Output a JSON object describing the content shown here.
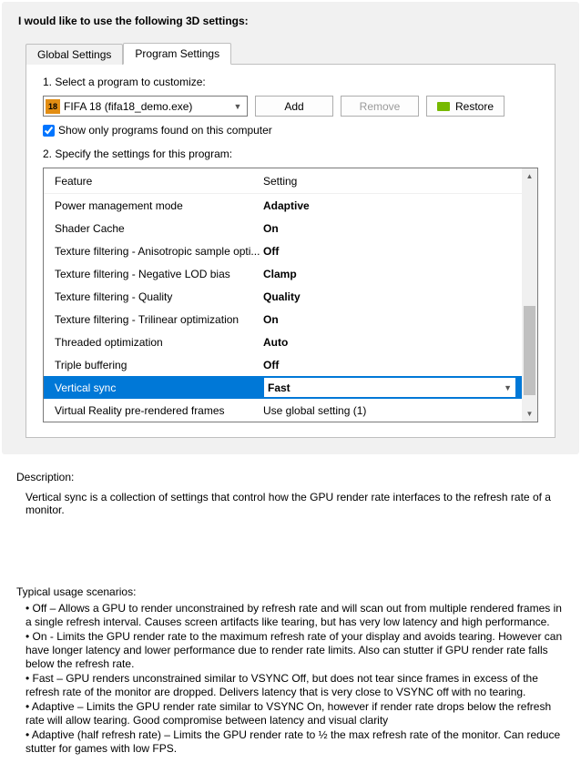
{
  "panel": {
    "title": "I would like to use the following 3D settings:"
  },
  "tabs": {
    "global": "Global Settings",
    "program": "Program Settings"
  },
  "step1": {
    "label": "1. Select a program to customize:",
    "program_icon_text": "18",
    "program_text": "FIFA 18 (fifa18_demo.exe)",
    "add": "Add",
    "remove": "Remove",
    "restore": "Restore",
    "checkbox_checked": true,
    "checkbox_label": "Show only programs found on this computer"
  },
  "step2": {
    "label": "2. Specify the settings for this program:",
    "header_feature": "Feature",
    "header_setting": "Setting",
    "rows": [
      {
        "feature": "Power management mode",
        "setting": "Adaptive"
      },
      {
        "feature": "Shader Cache",
        "setting": "On"
      },
      {
        "feature": "Texture filtering - Anisotropic sample opti...",
        "setting": "Off"
      },
      {
        "feature": "Texture filtering - Negative LOD bias",
        "setting": "Clamp"
      },
      {
        "feature": "Texture filtering - Quality",
        "setting": "Quality"
      },
      {
        "feature": "Texture filtering - Trilinear optimization",
        "setting": "On"
      },
      {
        "feature": "Threaded optimization",
        "setting": "Auto"
      },
      {
        "feature": "Triple buffering",
        "setting": "Off"
      },
      {
        "feature": "Vertical sync",
        "setting": "Fast",
        "selected": true
      },
      {
        "feature": "Virtual Reality pre-rendered frames",
        "setting": "Use global setting (1)",
        "last": true
      }
    ]
  },
  "description": {
    "title": "Description:",
    "body": "Vertical sync is a collection of settings that control how the GPU render rate interfaces to the refresh rate of a monitor."
  },
  "scenarios": {
    "title": "Typical usage scenarios:",
    "items": [
      "• Off – Allows a GPU to render unconstrained by refresh rate and will scan out from multiple rendered frames in a single refresh interval. Causes screen artifacts like tearing, but has very low latency and high performance.",
      "• On - Limits the GPU render rate to the maximum refresh rate of your display and avoids tearing. However can have longer latency and lower performance due to render rate limits. Also can stutter if GPU render rate falls below the refresh rate.",
      "• Fast – GPU renders unconstrained similar to VSYNC Off, but does not tear since frames in excess of the refresh rate of the monitor are dropped. Delivers latency that is very close to VSYNC off with no tearing.",
      "• Adaptive – Limits the GPU render rate similar to VSYNC On, however if render rate drops below the refresh rate will allow tearing. Good compromise between latency and visual clarity",
      "• Adaptive (half refresh rate) – Limits the GPU render rate to ½ the max refresh rate of the monitor. Can reduce stutter for games with low FPS."
    ]
  }
}
